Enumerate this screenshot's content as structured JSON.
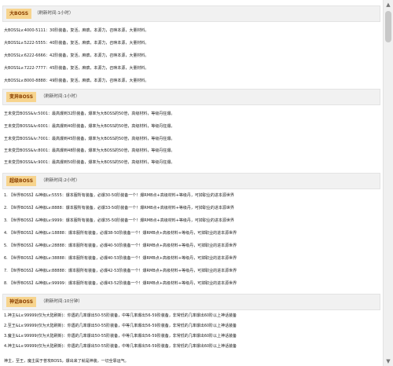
{
  "sections": [
    {
      "title": "大BOSS",
      "note": "（刷新时间:1小时）",
      "rows": [
        "大BOSSLv:4000-5111：30阶装备，复活，麻痹，本源力，召唤本源，大量材料。",
        "大BOSSLv:5222-5555：40阶装备，复活，麻痹，本源力，召唤本源，大量材料。",
        "大BOSSLv:6222-6666：42阶装备，复活，麻痹，本源力，召唤本源，大量材料。",
        "大BOSSLv:7222-7777：45阶装备，复活，麻痹，本源力，召唤本源，大量材料。",
        "大BOSSLv:8000-8888：49阶装备，复活，麻痹，本源力，召唤本源，大量材料。"
      ]
    },
    {
      "title": "变异BOSS",
      "note": "（刷新时间:1小时）",
      "rows": [
        "王未变异BOSS&lv:5001：最高爆到32阶装备，爆率为大BOSS的50倍，高级材料，等级丹狂爆。",
        "王未变异BOSS&lv:6001：最高爆到40阶装备，爆率为大BOSS的50倍，高级材料，等级丹狂爆。",
        "王未变异BOSS&lv:7001：最高爆到45阶装备，爆率为大BOSS的50倍，高级材料，等级丹狂爆。",
        "王未变异BOSS&lv:8001：最高爆到48阶装备，爆率为大BOSS的50倍，高级材料，等级丹狂爆。",
        "王未变异BOSS&lv:9001：最高爆到50阶装备，爆率为大BOSS的50倍，高级材料，等级丹狂爆。"
      ]
    },
    {
      "title": "超级BOSS",
      "note": "（刷新时间:2小时）",
      "rows": [
        "1. 【世界BOSS】&神级Lv:5555：爆本服所有装备，必爆30-50阶装备一个！爆RMB点+高级材料+等级丹，可掉职业的进本源世界",
        "2. 【世界BOSS】&神级Lv:8888：爆本服所有装备，必爆33-50阶装备一个！爆RMB点+高级材料+等级丹，可掉职业的进本源世界",
        "3. 【世界BOSS】&神级Lv:9999：爆本服所有装备，必爆35-50阶装备一个！爆RMB点+高级材料+等级丹，可掉职业的进本源世界",
        "4. 【世界BOSS】&神级Lv:18888：爆本服所有装备，必爆38-50阶装备一个！爆RMB点+高级材料+等级丹，可掉职业的进本源世界",
        "5. 【世界BOSS】&神级Lv:28888：爆本服所有装备，必爆40-50阶装备一个！爆RMB点+高级材料+等级丹，可掉职业的进本源世界",
        "6. 【世界BOSS】&神级Lv:38888：爆本服所有装备，必爆40-53阶装备一个！爆RMB点+高级材料+等级丹，可掉职业的进本源世界",
        "7. 【世界BOSS】&神级Lv:88888：爆本服所有装备，必爆42-53阶装备一个！爆RMB点+高级材料+等级丹，可掉职业的进本源世界",
        "8. 【世界BOSS】&神级Lv:99999：爆本服所有装备，必爆43-52阶装备一个！爆RMB点+高级材料+等级丹，可掉职业的进本源世界"
      ]
    },
    {
      "title": "神话BOSS",
      "note": "（刷新时间:10分钟）",
      "rows": [
        "1.神主&Lv:99999(仅为大陆刷新)：你遇的几率爆出50-55阶装备，中等几率爆出56-59阶装备，非常低的几率爆出60阶以上神话装备",
        "2.至王&Lv:99999(仅为大陆刷新)：你遇的几率爆出50-55阶装备，中等几率爆出56-59阶装备，非常低的几率爆出60阶以上神话装备",
        "3.魔主&Lv:99999(仅为大陆刷新)：你遇的几率爆出50-55阶装备，中等几率爆出56-59阶装备，非常低的几率爆出60阶以上神话装备",
        "4.神主&Lv:99999(仅为大陆刷新)：你遇的几率爆出50-55阶装备，中等几率爆出56-59阶装备，非常低的几率爆出60阶以上神话装备"
      ]
    }
  ],
  "footer": "神主，至王，魔主属于普攻BOSS，爆出来了就是神装，一切全靠运气。"
}
